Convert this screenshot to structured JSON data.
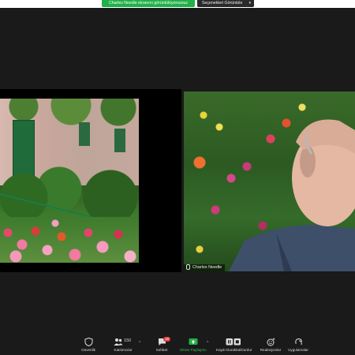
{
  "top_bar": {
    "share_status": "Charles Needle ekranını görüntülüyorsunuz",
    "view_options": "Seçenekleri Görüntüle"
  },
  "participant": {
    "name": "Charles Needle"
  },
  "toolbar": {
    "security": "Güvenlik",
    "participants": "Katılımcılar",
    "participants_count": "150",
    "chat": "Sohbet",
    "chat_badge": "18",
    "share_screen": "Ekran Paylaşımı",
    "record": "Kaydı Duraklat/Durdur",
    "reactions": "Reaksiyonlar",
    "apps": "Uygulamalar"
  },
  "colors": {
    "accent_green": "#22b04a",
    "toolbar_bg": "#1a1a1a",
    "badge_red": "#e23b3b"
  },
  "icons": [
    "shield-icon",
    "people-icon",
    "chat-icon",
    "share-screen-icon",
    "pause-stop-icon",
    "reaction-icon",
    "apps-icon"
  ]
}
